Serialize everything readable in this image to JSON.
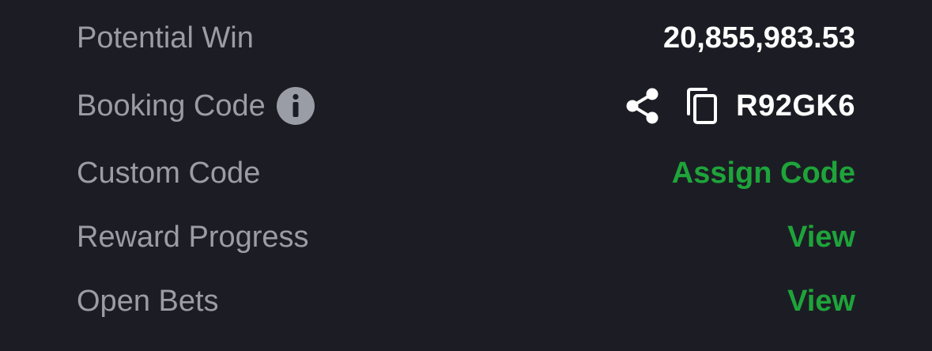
{
  "summary": {
    "potential_win": {
      "label": "Potential Win",
      "value": "20,855,983.53"
    },
    "booking_code": {
      "label": "Booking Code",
      "info_icon": "info-circle-icon",
      "share_icon": "share-icon",
      "copy_icon": "copy-icon",
      "value": "R92GK6"
    },
    "custom_code": {
      "label": "Custom Code",
      "action": "Assign Code"
    },
    "reward_progress": {
      "label": "Reward Progress",
      "action": "View"
    },
    "open_bets": {
      "label": "Open Bets",
      "action": "View"
    }
  },
  "colors": {
    "background": "#1c1d24",
    "label": "#9a9ca6",
    "value": "#ffffff",
    "accent_green": "#1ea43a",
    "info_icon": "#9a9ca6"
  }
}
